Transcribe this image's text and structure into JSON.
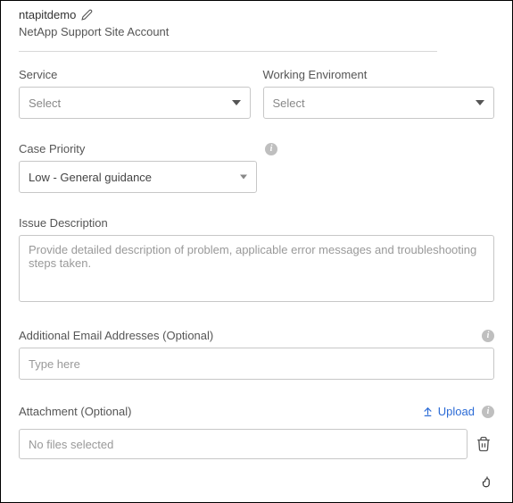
{
  "header": {
    "account_name": "ntapitdemo",
    "subtitle": "NetApp Support Site Account"
  },
  "fields": {
    "service": {
      "label": "Service",
      "placeholder": "Select"
    },
    "environment": {
      "label": "Working Enviroment",
      "placeholder": "Select"
    },
    "priority": {
      "label": "Case Priority",
      "value": "Low - General guidance"
    },
    "issue": {
      "label": "Issue Description",
      "placeholder": "Provide detailed description of problem, applicable error messages and troubleshooting steps taken."
    },
    "emails": {
      "label": "Additional Email Addresses (Optional)",
      "placeholder": "Type here"
    },
    "attachment": {
      "label": "Attachment (Optional)",
      "upload_label": "Upload",
      "no_files": "No files selected"
    }
  }
}
